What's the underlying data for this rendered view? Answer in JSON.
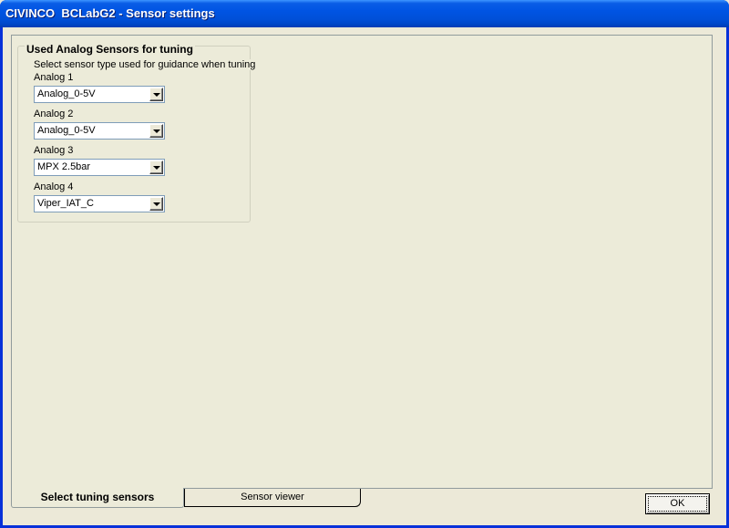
{
  "window": {
    "title": "CIVINCO  BCLabG2 - Sensor settings"
  },
  "group": {
    "title": "Used Analog Sensors for tuning",
    "subtitle": "Select sensor type used for guidance when tuning"
  },
  "sensors": [
    {
      "label": "Analog 1",
      "value": "Analog_0-5V"
    },
    {
      "label": "Analog 2",
      "value": "Analog_0-5V"
    },
    {
      "label": "Analog 3",
      "value": "MPX 2.5bar"
    },
    {
      "label": "Analog 4",
      "value": "Viper_IAT_C"
    }
  ],
  "tabs": [
    {
      "label": "Select tuning sensors",
      "active": true
    },
    {
      "label": "Sensor viewer",
      "active": false
    }
  ],
  "buttons": {
    "ok_label": "OK"
  }
}
